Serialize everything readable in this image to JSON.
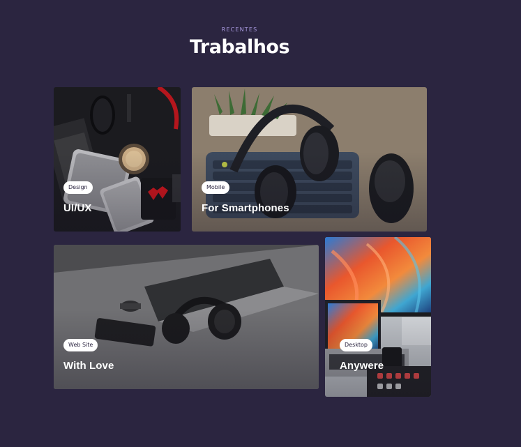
{
  "section": {
    "eyebrow": "RECENTES",
    "title": "Trabalhos"
  },
  "cards": [
    {
      "tag": "Design",
      "title": "UI/UX",
      "image": "desk-gadgets-photo"
    },
    {
      "tag": "Mobile",
      "title": "For Smartphones",
      "image": "headphones-keyboard-photo"
    },
    {
      "tag": "Web Site",
      "title": "With Love",
      "image": "laptop-headphones-photo"
    },
    {
      "tag": "Desktop",
      "title": "Anywere",
      "image": "monitor-macbook-photo"
    }
  ],
  "colors": {
    "background": "#2b2540",
    "accent": "#a99ae0",
    "tag_bg": "#ffffff",
    "text": "#ffffff"
  }
}
